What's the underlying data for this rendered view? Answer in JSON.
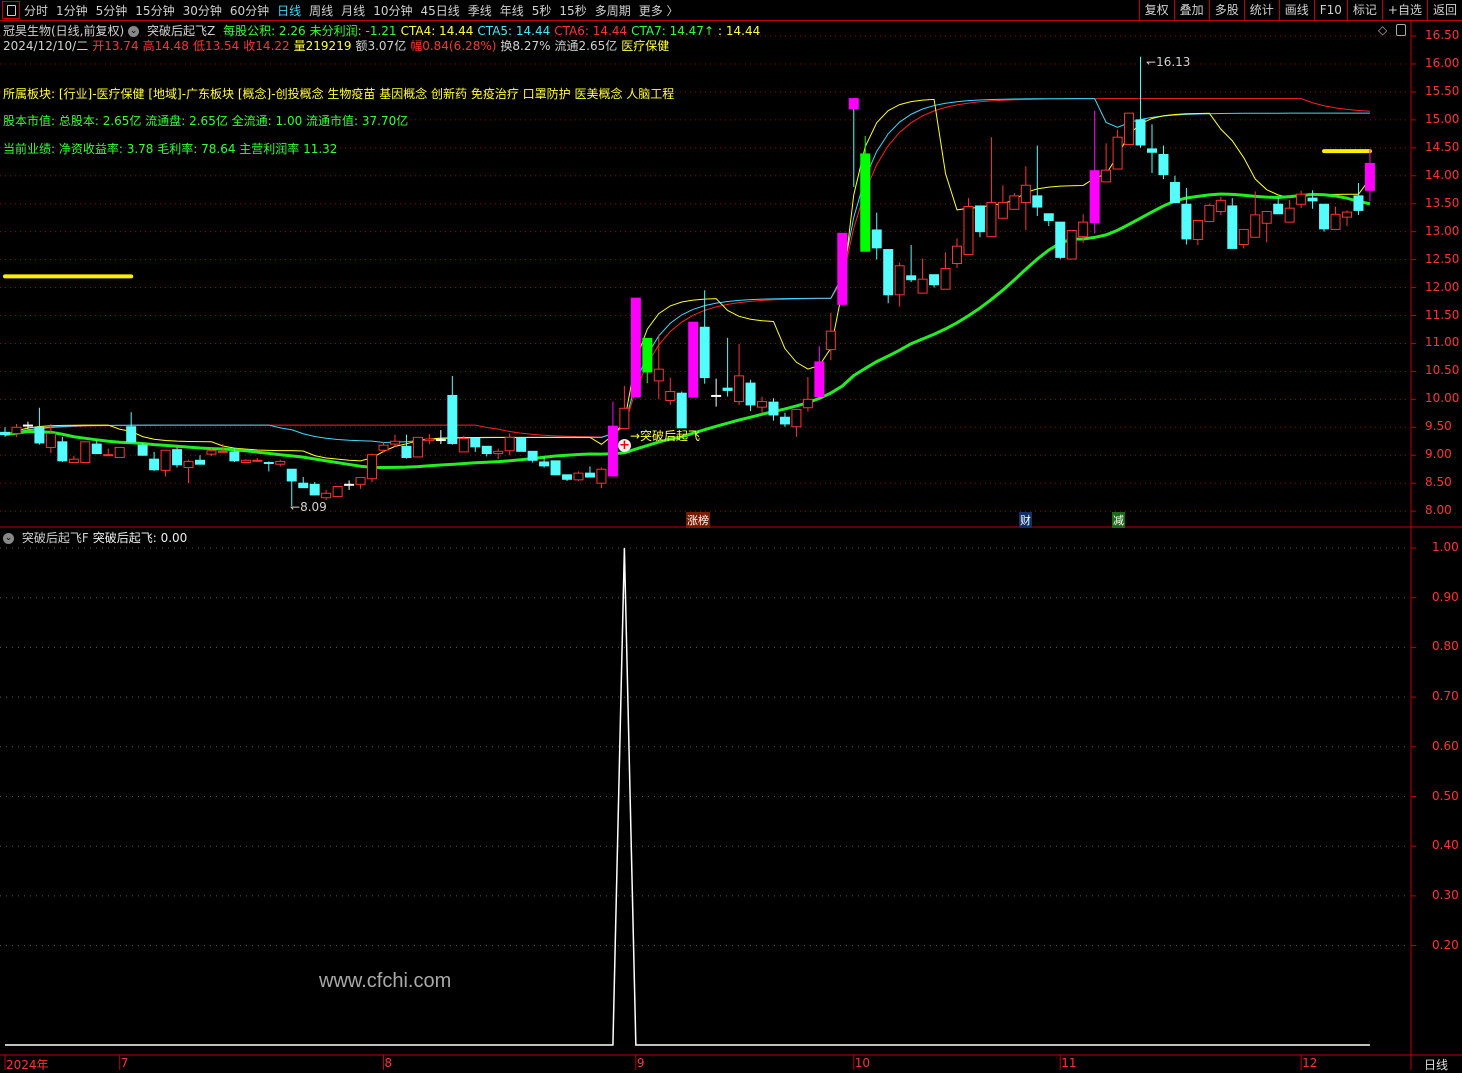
{
  "toolbar": {
    "periods": [
      "分时",
      "1分钟",
      "5分钟",
      "15分钟",
      "30分钟",
      "60分钟",
      "日线",
      "周线",
      "月线",
      "10分钟",
      "45日线",
      "季线",
      "年线",
      "5秒",
      "15秒",
      "多周期",
      "更多 〉"
    ],
    "active_period": "日线",
    "right_buttons": [
      "复权",
      "叠加",
      "多股",
      "统计",
      "画线",
      "F10",
      "标记",
      "+自选",
      "返回"
    ]
  },
  "header": {
    "title": "冠昊生物(日线,前复权)",
    "indicator_name": "突破后起飞Z",
    "items": [
      {
        "text": "每股公积: 2.26",
        "color": "g"
      },
      {
        "text": "未分利润: -1.21",
        "color": "g"
      },
      {
        "text": "CTA4: 14.44",
        "color": "y"
      },
      {
        "text": "CTA5: 14.44",
        "color": "c"
      },
      {
        "text": "CTA6: 14.44",
        "color": "r"
      },
      {
        "text": "CTA7: 14.47↑",
        "color": "g"
      },
      {
        "text": ": 14.44",
        "color": "y"
      }
    ],
    "quote": [
      {
        "text": "2024/12/10/二",
        "color": "w"
      },
      {
        "text": "开13.74",
        "color": "r"
      },
      {
        "text": "高14.48",
        "color": "r"
      },
      {
        "text": "低13.54",
        "color": "r"
      },
      {
        "text": "收14.22",
        "color": "r"
      },
      {
        "text": "量219219",
        "color": "y"
      },
      {
        "text": "额3.07亿",
        "color": "w"
      },
      {
        "text": "幅0.84(6.28%)",
        "color": "r"
      },
      {
        "text": "换8.27%",
        "color": "w"
      },
      {
        "text": "流通2.65亿",
        "color": "w"
      },
      {
        "text": "医疗保健",
        "color": "y"
      }
    ]
  },
  "fundamentals": {
    "sectors": "所属板块: [行业]-医疗保健 [地域]-广东板块 [概念]-创投概念 生物疫苗 基因概念 创新药 免疫治疗 口罩防护 医美概念 人脑工程",
    "shares": "股本市值: 总股本: 2.65亿 流通盘: 2.65亿 全流通: 1.00 流通市值: 37.70亿",
    "performance": "当前业绩: 净资收益率: 3.78 毛利率: 78.64 主营利润率 11.32"
  },
  "annotations": {
    "low_label": "8.09",
    "high_label": "16.13",
    "signal_label": "→突破后起飞",
    "tag_zhangbang": "涨榜",
    "tag_cai": "财",
    "tag_jian": "减",
    "watermark": "www.cfchi.com"
  },
  "lower_panel": {
    "title": "突破后起飞F",
    "value_text": "突破后起飞: 0.00"
  },
  "period_label": "日线",
  "colors": {
    "up": "#ff3232",
    "down": "#54fcfc",
    "special_up": "#ff00ff",
    "special_down": "#00ff00",
    "doji": "#ffffff",
    "grid": "#a00000",
    "ma_long": "#22ee22"
  },
  "chart_data": {
    "type": "candlestick",
    "title": "冠昊生物 日线",
    "y_ticks": [
      "16.50",
      "16.00",
      "15.50",
      "15.00",
      "14.50",
      "14.00",
      "13.50",
      "13.00",
      "12.50",
      "12.00",
      "11.50",
      "11.00",
      "10.50",
      "10.00",
      "9.50",
      "9.00",
      "8.50",
      "8.00"
    ],
    "ylim": [
      8.0,
      16.5
    ],
    "x_ticks": [
      {
        "label": "2024年",
        "index": 0
      },
      {
        "label": "7",
        "index": 10
      },
      {
        "label": "8",
        "index": 33
      },
      {
        "label": "9",
        "index": 55
      },
      {
        "label": "10",
        "index": 74
      },
      {
        "label": "11",
        "index": 92
      },
      {
        "label": "12",
        "index": 113
      }
    ],
    "highlight_levels": [
      {
        "value": 12.2,
        "from": 0,
        "to": 11
      },
      {
        "value": 14.44,
        "from": 115,
        "to": 119
      }
    ],
    "candles_fields": [
      "open",
      "high",
      "low",
      "close",
      "flag"
    ],
    "candles": [
      [
        9.41,
        9.5,
        9.33,
        9.37
      ],
      [
        9.39,
        9.56,
        9.33,
        9.5
      ],
      [
        9.54,
        9.6,
        9.47,
        9.54,
        "x"
      ],
      [
        9.5,
        9.85,
        9.19,
        9.22
      ],
      [
        9.14,
        9.56,
        9.04,
        9.39
      ],
      [
        9.24,
        9.33,
        8.88,
        8.9
      ],
      [
        8.87,
        8.99,
        8.87,
        8.93
      ],
      [
        8.87,
        9.24,
        8.87,
        9.24
      ],
      [
        9.2,
        9.26,
        9.03,
        9.03
      ],
      [
        9.0,
        9.12,
        9.0,
        9.01
      ],
      [
        8.96,
        9.14,
        8.96,
        9.14
      ],
      [
        9.51,
        9.77,
        9.22,
        9.24
      ],
      [
        9.18,
        9.22,
        8.99,
        9.0
      ],
      [
        8.93,
        9.06,
        8.72,
        8.74
      ],
      [
        8.73,
        9.1,
        8.62,
        9.09
      ],
      [
        9.1,
        9.14,
        8.78,
        8.83
      ],
      [
        8.78,
        8.92,
        8.5,
        8.89
      ],
      [
        8.91,
        9.0,
        8.84,
        8.84
      ],
      [
        9.02,
        9.12,
        8.99,
        9.08
      ],
      [
        9.06,
        9.2,
        9.06,
        9.07
      ],
      [
        9.06,
        9.13,
        8.88,
        8.9
      ],
      [
        8.87,
        8.93,
        8.87,
        8.91
      ],
      [
        8.9,
        8.95,
        8.9,
        8.91
      ],
      [
        8.87,
        8.89,
        8.71,
        8.86
      ],
      [
        8.84,
        8.92,
        8.8,
        8.89
      ],
      [
        8.75,
        8.75,
        8.09,
        8.54
      ],
      [
        8.5,
        8.61,
        8.42,
        8.42
      ],
      [
        8.48,
        8.52,
        8.29,
        8.29
      ],
      [
        8.24,
        8.38,
        8.2,
        8.32
      ],
      [
        8.26,
        8.44,
        8.26,
        8.44
      ],
      [
        8.48,
        8.55,
        8.38,
        8.48,
        "x"
      ],
      [
        8.48,
        8.6,
        8.4,
        8.6
      ],
      [
        8.58,
        9.03,
        8.52,
        9.01
      ],
      [
        9.09,
        9.24,
        9.05,
        9.18
      ],
      [
        9.2,
        9.37,
        9.15,
        9.25
      ],
      [
        9.16,
        9.37,
        8.94,
        8.96
      ],
      [
        8.97,
        9.32,
        8.97,
        9.32
      ],
      [
        9.26,
        9.38,
        9.2,
        9.29
      ],
      [
        9.28,
        9.45,
        9.2,
        9.28,
        "x"
      ],
      [
        10.07,
        10.42,
        9.19,
        9.21
      ],
      [
        9.06,
        9.35,
        9.06,
        9.3
      ],
      [
        9.3,
        9.3,
        9.06,
        9.15
      ],
      [
        9.16,
        9.16,
        8.98,
        9.03
      ],
      [
        9.03,
        9.12,
        8.93,
        9.07
      ],
      [
        9.08,
        9.39,
        9.0,
        9.32
      ],
      [
        9.31,
        9.31,
        9.07,
        9.07
      ],
      [
        9.07,
        9.07,
        8.87,
        8.91
      ],
      [
        8.88,
        8.97,
        8.78,
        8.81
      ],
      [
        8.9,
        8.9,
        8.65,
        8.65
      ],
      [
        8.65,
        8.65,
        8.54,
        8.57
      ],
      [
        8.56,
        8.71,
        8.54,
        8.68
      ],
      [
        8.68,
        8.8,
        8.61,
        8.61
      ],
      [
        8.5,
        8.78,
        8.41,
        8.75
      ],
      [
        8.63,
        9.96,
        8.63,
        9.52,
        "m"
      ],
      [
        9.48,
        10.24,
        9.48,
        9.84
      ],
      [
        10.05,
        11.81,
        10.05,
        11.81,
        "m"
      ],
      [
        11.09,
        11.09,
        10.29,
        10.49,
        "g"
      ],
      [
        10.33,
        11.16,
        10.0,
        10.54
      ],
      [
        9.98,
        10.39,
        9.9,
        10.14
      ],
      [
        10.11,
        10.14,
        9.49,
        9.49
      ],
      [
        10.04,
        11.38,
        10.04,
        11.38,
        "m"
      ],
      [
        11.29,
        11.95,
        10.28,
        10.39
      ],
      [
        10.07,
        10.37,
        9.87,
        10.07,
        "x"
      ],
      [
        10.2,
        11.1,
        10.05,
        10.16
      ],
      [
        9.96,
        10.99,
        9.9,
        10.42
      ],
      [
        10.29,
        10.35,
        9.79,
        9.9
      ],
      [
        9.86,
        10.05,
        9.75,
        9.96
      ],
      [
        9.95,
        10.02,
        9.62,
        9.72
      ],
      [
        9.68,
        9.76,
        9.51,
        9.56
      ],
      [
        9.51,
        9.82,
        9.33,
        9.82
      ],
      [
        9.85,
        10.4,
        9.78,
        10.0
      ],
      [
        10.05,
        10.95,
        10.05,
        10.67,
        "m"
      ],
      [
        10.89,
        11.55,
        10.7,
        11.22
      ],
      [
        11.7,
        12.97,
        11.7,
        12.97,
        "m"
      ],
      [
        15.2,
        15.38,
        13.8,
        15.38,
        "m"
      ],
      [
        14.39,
        14.71,
        12.65,
        12.65,
        "g"
      ],
      [
        13.03,
        13.34,
        12.5,
        12.71
      ],
      [
        12.68,
        12.68,
        11.72,
        11.87
      ],
      [
        11.87,
        12.45,
        11.66,
        12.39
      ],
      [
        12.21,
        12.76,
        12.1,
        12.14
      ],
      [
        11.9,
        12.52,
        11.9,
        12.15
      ],
      [
        12.23,
        12.23,
        12.0,
        12.05
      ],
      [
        11.97,
        12.63,
        11.97,
        12.34
      ],
      [
        12.43,
        12.88,
        12.35,
        12.74
      ],
      [
        12.59,
        13.6,
        12.59,
        13.45
      ],
      [
        13.46,
        13.46,
        12.9,
        13.0
      ],
      [
        12.91,
        14.69,
        12.91,
        13.52
      ],
      [
        13.24,
        13.83,
        13.24,
        13.52
      ],
      [
        13.4,
        13.69,
        13.4,
        13.64
      ],
      [
        13.52,
        14.17,
        13.03,
        13.83
      ],
      [
        13.64,
        14.54,
        13.28,
        13.44
      ],
      [
        13.32,
        13.32,
        13.1,
        13.2
      ],
      [
        13.17,
        13.17,
        12.51,
        12.54
      ],
      [
        12.51,
        13.02,
        12.51,
        13.02
      ],
      [
        12.91,
        13.31,
        12.8,
        13.17
      ],
      [
        13.16,
        15.16,
        12.97,
        14.09,
        "m"
      ],
      [
        13.89,
        14.58,
        13.89,
        14.1
      ],
      [
        14.12,
        14.82,
        14.12,
        14.69
      ],
      [
        14.56,
        15.12,
        14.56,
        15.12
      ],
      [
        15.0,
        16.13,
        14.5,
        14.55
      ],
      [
        14.48,
        14.92,
        14.05,
        14.42
      ],
      [
        14.38,
        14.54,
        13.94,
        14.02
      ],
      [
        13.88,
        14.0,
        13.52,
        13.52
      ],
      [
        13.49,
        13.78,
        12.77,
        12.87
      ],
      [
        12.86,
        13.2,
        12.76,
        13.2
      ],
      [
        13.18,
        13.5,
        13.18,
        13.47
      ],
      [
        13.36,
        13.62,
        13.3,
        13.56
      ],
      [
        13.46,
        13.6,
        12.7,
        12.7
      ],
      [
        12.77,
        13.04,
        12.7,
        13.04
      ],
      [
        12.9,
        13.72,
        12.9,
        13.3
      ],
      [
        13.15,
        13.36,
        12.81,
        13.36
      ],
      [
        13.49,
        13.6,
        13.32,
        13.32
      ],
      [
        13.17,
        13.57,
        13.17,
        13.42
      ],
      [
        13.49,
        13.73,
        13.42,
        13.67
      ],
      [
        13.6,
        13.74,
        13.41,
        13.55
      ],
      [
        13.49,
        13.49,
        13.0,
        13.05
      ],
      [
        13.04,
        13.45,
        13.04,
        13.31
      ],
      [
        13.26,
        13.38,
        13.1,
        13.35
      ],
      [
        13.64,
        13.87,
        13.3,
        13.38
      ],
      [
        13.74,
        14.48,
        13.54,
        14.22,
        "m"
      ]
    ],
    "signal_index": 54,
    "markers": [
      {
        "label_key": "tag_zhangbang",
        "index": 60
      },
      {
        "label_key": "tag_cai",
        "index": 89
      },
      {
        "label_key": "tag_jian",
        "index": 97
      }
    ],
    "indicator": {
      "name": "突破后起飞",
      "y_ticks": [
        "1.00",
        "0.90",
        "0.80",
        "0.70",
        "0.60",
        "0.50",
        "0.40",
        "0.30",
        "0.20"
      ],
      "ylim": [
        0,
        1.0
      ],
      "default_value": 0,
      "peak_index": 54,
      "peak_value": 1.0
    }
  }
}
